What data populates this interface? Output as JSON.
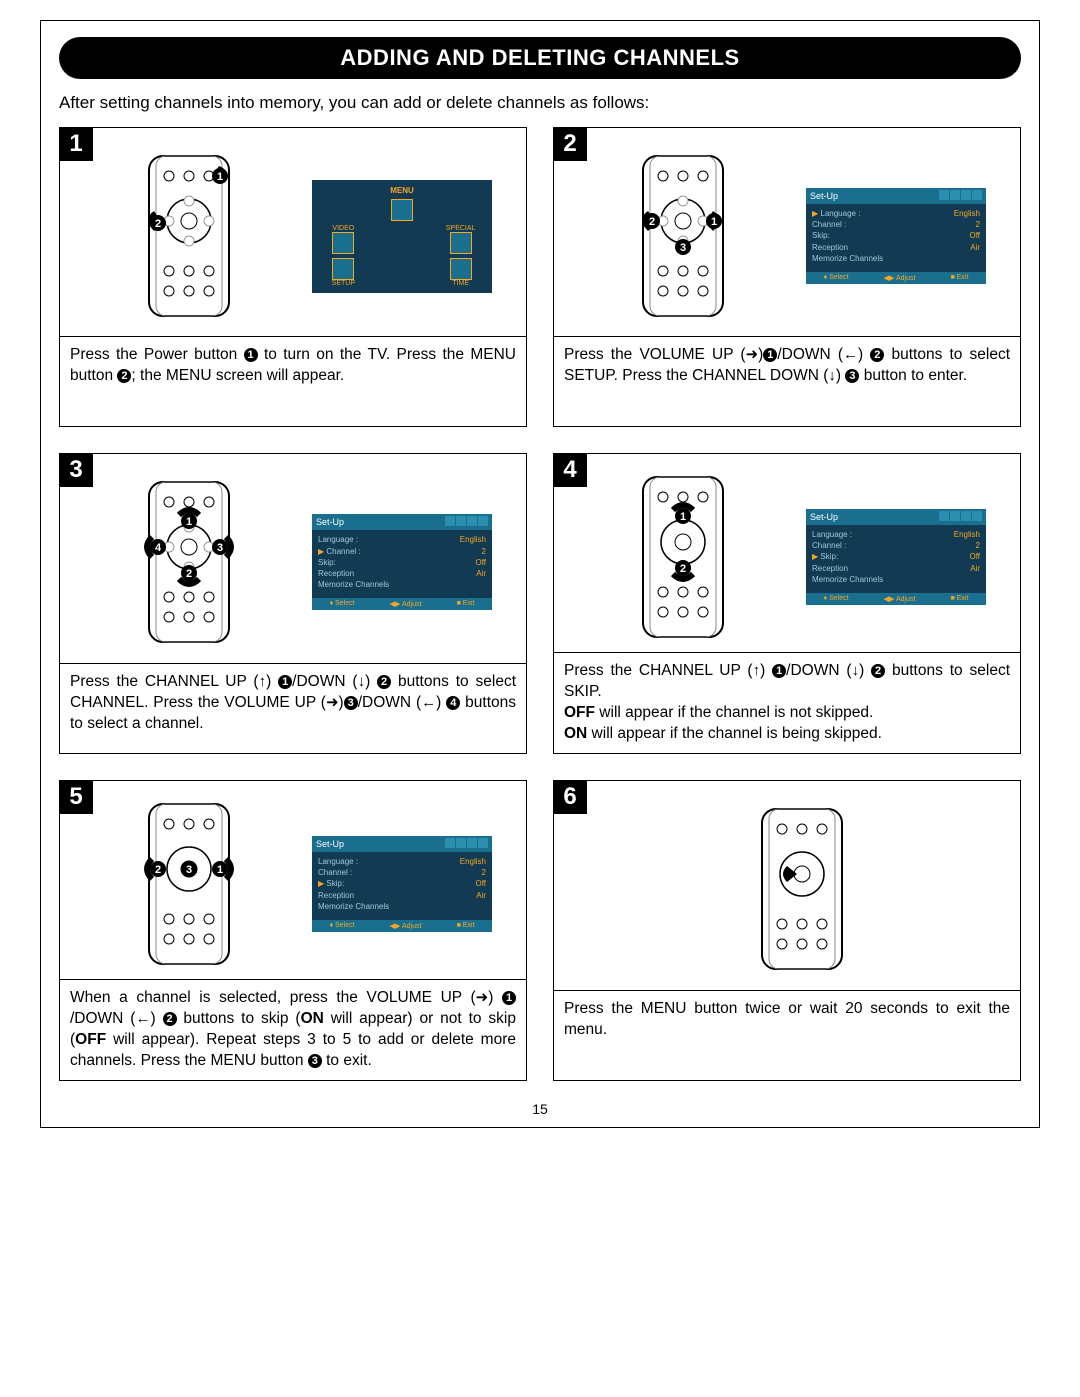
{
  "title": "ADDING AND DELETING CHANNELS",
  "intro": "After setting channels into memory, you can add or delete channels as follows:",
  "page_number": "15",
  "menu_osd": {
    "title": "MENU",
    "items": [
      "VIDEO",
      "SPECIAL",
      "SETUP",
      "TIME"
    ]
  },
  "setup_osd": {
    "title": "Set-Up",
    "rows": [
      {
        "label": "Language :",
        "value": "English"
      },
      {
        "label": "Channel :",
        "value": "2"
      },
      {
        "label": "Skip:",
        "value": "Off"
      },
      {
        "label": "Reception",
        "value": "Air"
      },
      {
        "label": "Memorize Channels",
        "value": ""
      }
    ],
    "footer": [
      "♦ Select",
      "◀▶ Adjust",
      "■ Exit"
    ]
  },
  "steps": [
    {
      "num": "1",
      "caption_parts": [
        "Press the Power button ",
        " to turn on the TV. Press the MENU button ",
        "; the MENU screen will appear."
      ],
      "marks": [
        "1",
        "2"
      ]
    },
    {
      "num": "2",
      "caption_parts": [
        "Press the VOLUME UP (",
        "➜",
        ")",
        "/DOWN (",
        "←",
        ") ",
        " buttons to select SETUP. Press the CHANNEL DOWN (",
        "↓",
        ") ",
        " button to enter."
      ],
      "marks": [
        "1",
        "2",
        "3"
      ],
      "osd_selected": 0
    },
    {
      "num": "3",
      "caption_parts": [
        "Press the CHANNEL UP (",
        "↑",
        ") ",
        "/DOWN (",
        "↓",
        ") ",
        " buttons to select CHANNEL. Press the VOLUME UP (",
        "➜",
        ")",
        "/DOWN (",
        "←",
        ") ",
        " buttons to select a channel."
      ],
      "marks": [
        "1",
        "2",
        "3",
        "4"
      ],
      "osd_selected": 1
    },
    {
      "num": "4",
      "caption_parts": [
        "Press the CHANNEL UP (",
        "↑",
        ") ",
        "/DOWN (",
        "↓",
        ") ",
        " buttons to select SKIP."
      ],
      "extra_lines": [
        "OFF",
        " will appear if the channel is not skipped.",
        "ON",
        " will appear if the channel is being skipped."
      ],
      "marks": [
        "1",
        "2"
      ],
      "osd_selected": 2
    },
    {
      "num": "5",
      "caption_parts": [
        "When a channel is selected, press the VOLUME UP (",
        "➜",
        ") ",
        "/DOWN (",
        "←",
        ") ",
        " buttons to skip (",
        "ON",
        " will appear) or not to skip (",
        "OFF",
        " will appear). Repeat steps 3 to 5 to add or delete more channels. Press the MENU button ",
        " to exit."
      ],
      "marks": [
        "1",
        "2",
        "3"
      ],
      "osd_selected": 2
    },
    {
      "num": "6",
      "caption_parts": [
        "Press the MENU button twice or wait 20 seconds to exit the menu."
      ],
      "marks": []
    }
  ]
}
